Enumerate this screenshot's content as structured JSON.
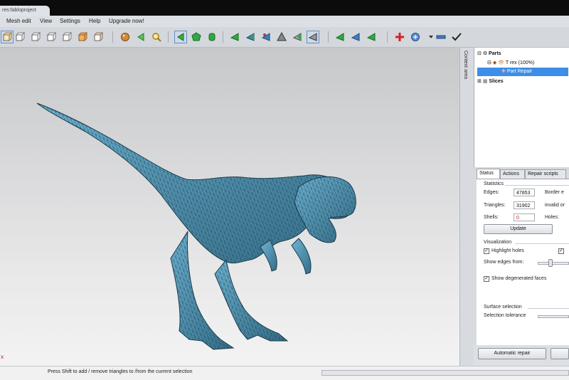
{
  "window": {
    "title": "res:fabloproject"
  },
  "menu": {
    "items": [
      {
        "label": "Mesh edit"
      },
      {
        "label": "View"
      },
      {
        "label": "Settings"
      },
      {
        "label": "Help"
      },
      {
        "label": "Upgrade now!"
      }
    ]
  },
  "toolbar": {
    "buttons": [
      {
        "icon": "view-cube-icon"
      },
      {
        "icon": "view-cube-icon"
      },
      {
        "icon": "view-cube-icon"
      },
      {
        "icon": "view-cube-icon"
      },
      {
        "icon": "view-cube-icon"
      },
      {
        "icon": "view-cube-icon"
      },
      {
        "icon": "view-cube-icon"
      },
      {
        "icon": "sphere-icon"
      },
      {
        "icon": "select-arrow-icon"
      },
      {
        "icon": "zoom-icon"
      },
      {
        "icon": "select-triangle-icon"
      },
      {
        "icon": "select-surface-icon"
      },
      {
        "icon": "select-shell-icon"
      },
      {
        "icon": "triangle-tool-icon"
      },
      {
        "icon": "triangle-tool-icon"
      },
      {
        "icon": "triangle-tool-icon"
      },
      {
        "icon": "triangle-tool-icon"
      },
      {
        "icon": "triangle-tool-icon"
      },
      {
        "icon": "triangle-tool-icon"
      },
      {
        "icon": "triangle-tool-icon"
      },
      {
        "icon": "triangle-tool-icon"
      },
      {
        "icon": "triangle-tool-icon"
      },
      {
        "icon": "add-part-icon"
      },
      {
        "icon": "scripts-icon"
      },
      {
        "icon": "remove-icon"
      },
      {
        "icon": "apply-check-icon"
      }
    ]
  },
  "context_area": {
    "label": "Context area"
  },
  "tree": {
    "parts_label": "Parts",
    "part_label": "T rex (100%)",
    "repair_label": "Part Repair",
    "slices_label": "Slices"
  },
  "tabs": [
    {
      "label": "Status"
    },
    {
      "label": "Actions"
    },
    {
      "label": "Repair scripts"
    }
  ],
  "status": {
    "statistics_label": "Statistics",
    "edges_label": "Edges:",
    "edges_value": "47853",
    "border_label": "Border e",
    "triangles_label": "Triangles:",
    "triangles_value": "31902",
    "invalid_label": "invalid or",
    "shells_label": "Shells:",
    "shells_value": "0",
    "holes_label": "Holes:",
    "update_button": "Update",
    "visualization_label": "Visualization",
    "highlight_holes_label": "Highlight holes",
    "highlight_holes_checked": true,
    "second_check_checked": true,
    "show_edges_label": "Show edges from:",
    "show_edges_level": 0.4,
    "degenerated_label": "Show degenerated faces",
    "degenerated_checked": true,
    "surface_selection_label": "Surface selection",
    "selection_tolerance_label": "Selection tolerance"
  },
  "bottom": {
    "auto_repair_button": "Automatic repair"
  },
  "statusbar": {
    "hint": "Press Shift to add / remove triangles to /from the current selection"
  },
  "colors": {
    "mesh": "#4d93b4",
    "selection": "#3c8ee6"
  }
}
